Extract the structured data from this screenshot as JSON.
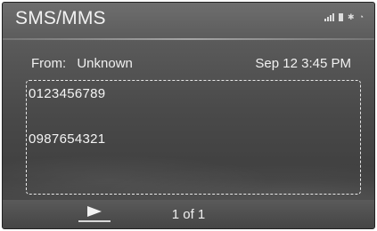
{
  "header": {
    "title": "SMS/MMS",
    "status_icons": [
      "signal-icon",
      "battery-icon",
      "bluetooth-icon",
      "wifi-icon"
    ]
  },
  "message": {
    "from_label": "From:",
    "from_value": "Unknown",
    "datetime": "Sep 12 3:45 PM",
    "body_lines": [
      "0123456789",
      "0987654321"
    ]
  },
  "footer": {
    "page_indicator": "1 of 1",
    "play_icon": "play-icon"
  }
}
